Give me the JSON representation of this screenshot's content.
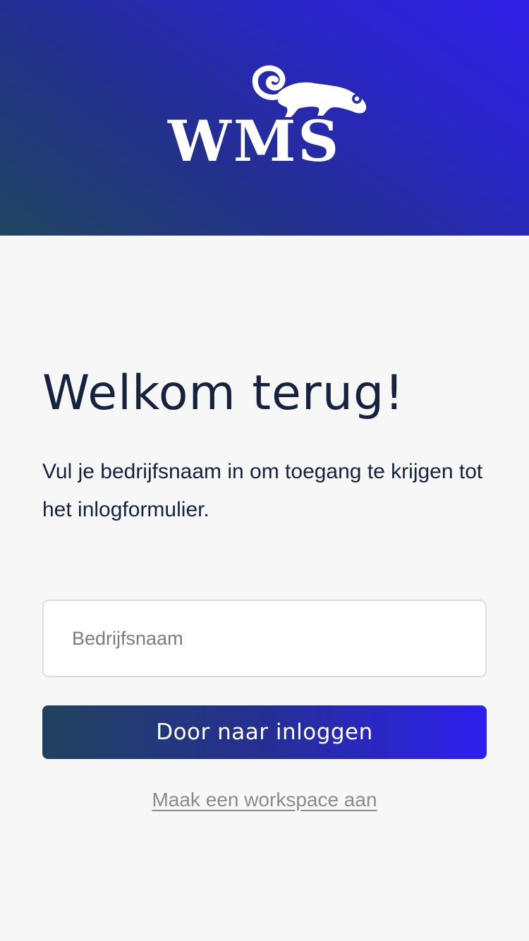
{
  "brand": {
    "logo_text": "WMS",
    "logo_mascot": "chameleon-icon",
    "gradient_start": "#1f4560",
    "gradient_end": "#2f1ee6"
  },
  "welcome": {
    "title": "Welkom terug!",
    "subtitle": "Vul je bedrijfsnaam in om toegang te krijgen tot het inlogformulier."
  },
  "form": {
    "company_value": "",
    "company_placeholder": "Bedrijfsnaam",
    "submit_label": "Door naar inloggen",
    "create_workspace_label": "Maak een workspace aan"
  },
  "colors": {
    "background": "#f7f7f8",
    "text": "#16233f",
    "link": "#8b8b8e"
  }
}
